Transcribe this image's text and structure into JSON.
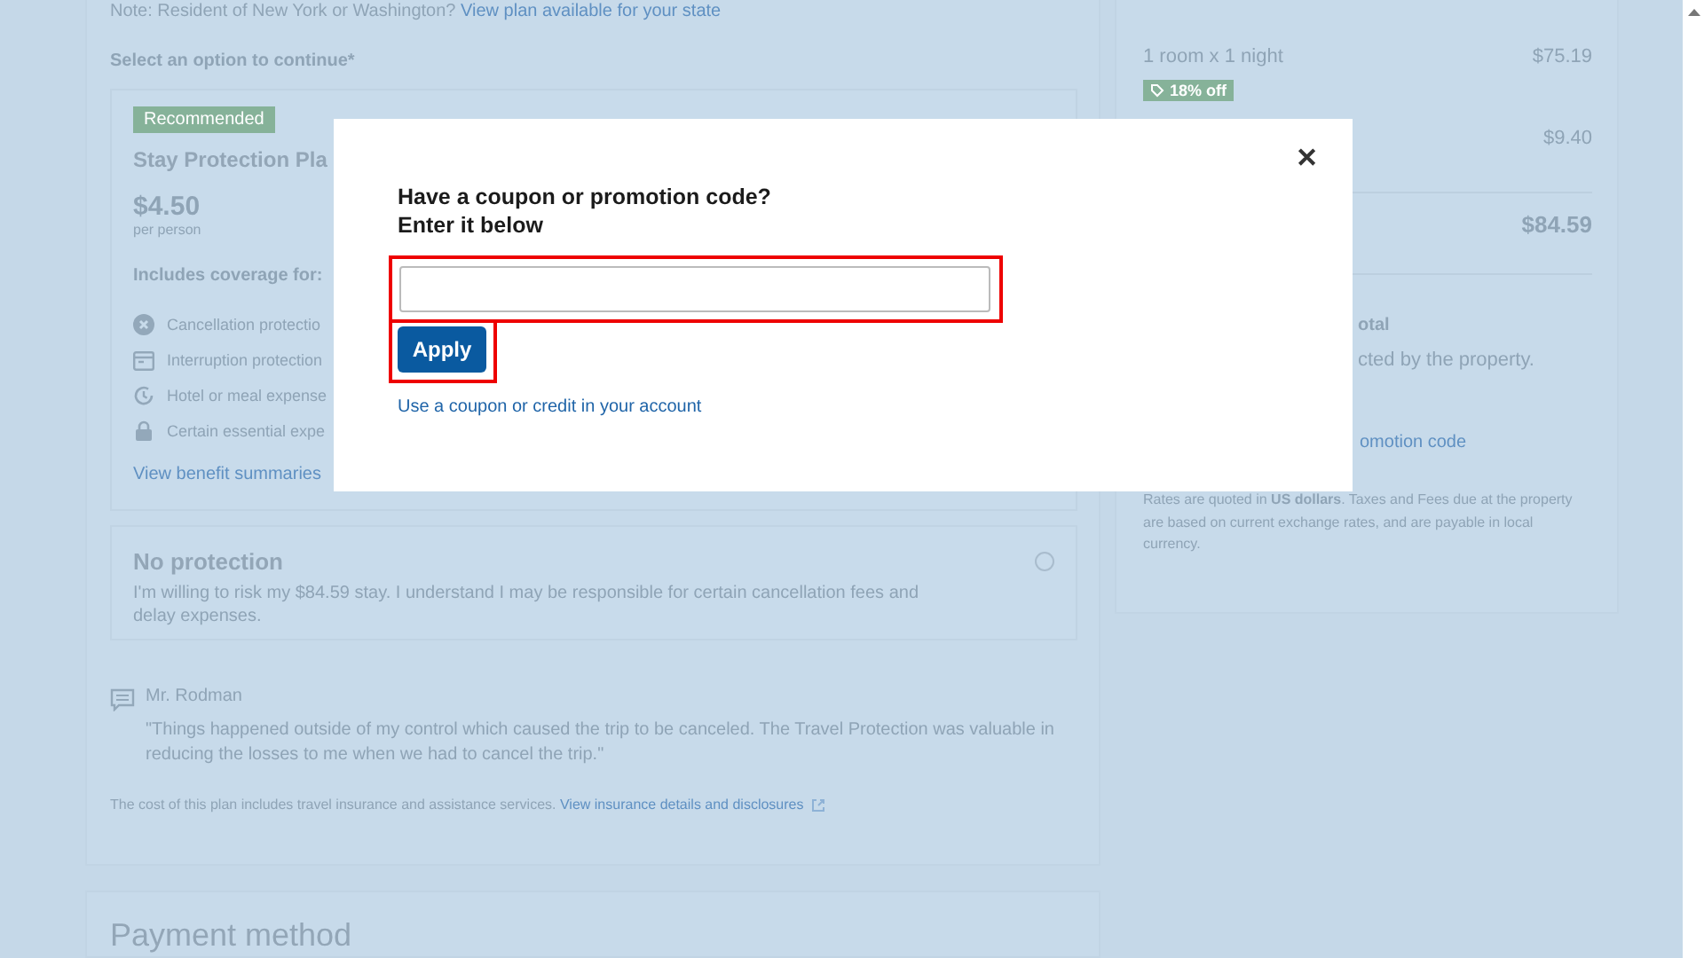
{
  "note": {
    "text": "Note: Resident of New York or Washington?",
    "link": "View plan available for your state"
  },
  "select_label": {
    "text": "Select an option to continue",
    "required_mark": "*"
  },
  "options": [
    {
      "kind": "plan",
      "badge": "Recommended",
      "title": "Stay Protection Pla",
      "price": "$4.50",
      "price_unit": "per person",
      "coverage_heading": "Includes coverage for:",
      "coverage_items": [
        {
          "kind": "cancel",
          "text": "Cancellation protectio"
        },
        {
          "kind": "interrupt",
          "text": "Interruption protection"
        },
        {
          "kind": "hotel",
          "text": "Hotel or meal expense"
        },
        {
          "kind": "essential",
          "text": "Certain essential expe"
        }
      ],
      "link": "View benefit summaries"
    },
    {
      "kind": "none",
      "title": "No protection",
      "description": "I'm willing to risk my $84.59 stay. I understand I may be responsible for certain cancellation fees and delay expenses.",
      "selected": false
    }
  ],
  "testimonial": {
    "author": "Mr. Rodman",
    "quote": "\"Things happened outside of my control which caused the trip to be canceled. The Travel Protection was valuable in reducing the losses to me when we had to cancel the trip.\""
  },
  "disclosure": {
    "text": "The cost of this plan includes travel insurance and assistance services.",
    "link": "View insurance details and disclosures"
  },
  "payment": {
    "heading": "Payment method"
  },
  "summary": {
    "lines": [
      {
        "label": "1 room x 1 night",
        "amount": "$75.19",
        "badge": "18% off"
      },
      {
        "amount": "$9.40"
      }
    ],
    "total": "$84.59",
    "total_note_title": "otal",
    "total_note_text": "cted by the property.",
    "promo_link": "omotion code",
    "currency_note": "Rates are quoted in **US dollars**. Taxes and Fees due at the property are based on current exchange rates, and are payable in local currency."
  },
  "modal": {
    "close": "✕",
    "title": "Have a coupon or promotion code?",
    "subtitle": "Enter it below",
    "apply_button": "Apply",
    "account_link": "Use a coupon or credit in your account"
  }
}
